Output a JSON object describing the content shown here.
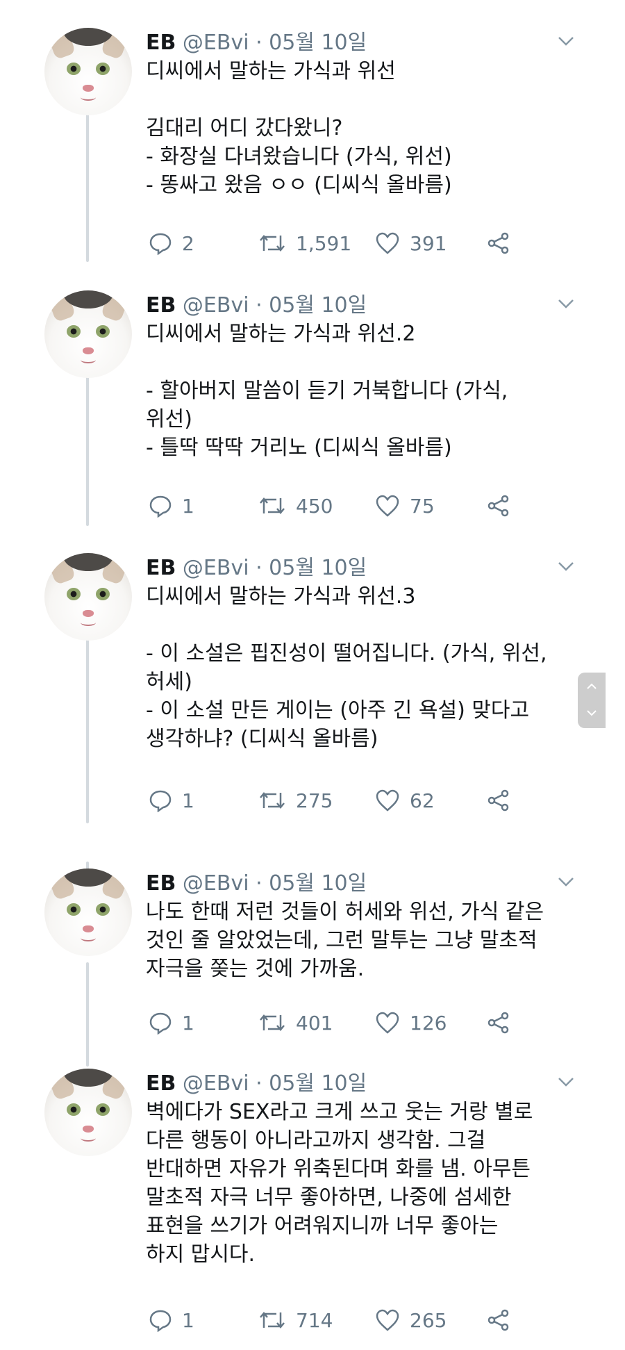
{
  "tweets": [
    {
      "name": "EB",
      "handle": "@EBvi · 05월 10일",
      "lines": [
        "디씨에서 말하는 가식과 위선",
        "",
        "김대리 어디 갔다왔니?",
        "- 화장실 다녀왔습니다 (가식, 위선)",
        "- 똥싸고 왔음 ㅇㅇ (디씨식 올바름)"
      ],
      "replies": "2",
      "retweets": "1,591",
      "likes": "391"
    },
    {
      "name": "EB",
      "handle": "@EBvi · 05월 10일",
      "lines": [
        "디씨에서 말하는 가식과 위선.2",
        "",
        "- 할아버지 말씀이 듣기 거북합니다 (가식,",
        "위선)",
        "- 틀딱 딱딱 거리노 (디씨식 올바름)"
      ],
      "replies": "1",
      "retweets": "450",
      "likes": "75"
    },
    {
      "name": "EB",
      "handle": "@EBvi · 05월 10일",
      "lines": [
        "디씨에서 말하는 가식과 위선.3",
        "",
        "- 이 소설은 핍진성이 떨어집니다. (가식, 위선,",
        "허세)",
        "- 이 소설 만든 게이는 (아주 긴 욕설) 맞다고",
        "생각하냐? (디씨식 올바름)"
      ],
      "replies": "1",
      "retweets": "275",
      "likes": "62"
    },
    {
      "name": "EB",
      "handle": "@EBvi · 05월 10일",
      "lines": [
        "나도 한때 저런 것들이 허세와 위선, 가식 같은",
        "것인 줄 알았었는데, 그런 말투는 그냥 말초적",
        "자극을 쫒는 것에 가까움."
      ],
      "replies": "1",
      "retweets": "401",
      "likes": "126"
    },
    {
      "name": "EB",
      "handle": "@EBvi · 05월 10일",
      "lines": [
        "벽에다가 SEX라고 크게 쓰고 웃는 거랑 별로",
        "다른 행동이 아니라고까지 생각함. 그걸",
        "반대하면 자유가 위축된다며 화를 냄. 아무튼",
        "말초적 자극 너무 좋아하면, 나중에 섬세한",
        "표현을 쓰기가 어려워지니까 너무 좋아는",
        "하지 맙시다."
      ],
      "replies": "1",
      "retweets": "714",
      "likes": "265"
    }
  ],
  "colors": {
    "text": "#14171a",
    "muted": "#657786",
    "thread": "#d4dadf"
  },
  "icons": [
    "reply-icon",
    "retweet-icon",
    "like-icon",
    "share-icon",
    "chevron-down-icon",
    "scroll-up-icon",
    "scroll-down-icon"
  ]
}
